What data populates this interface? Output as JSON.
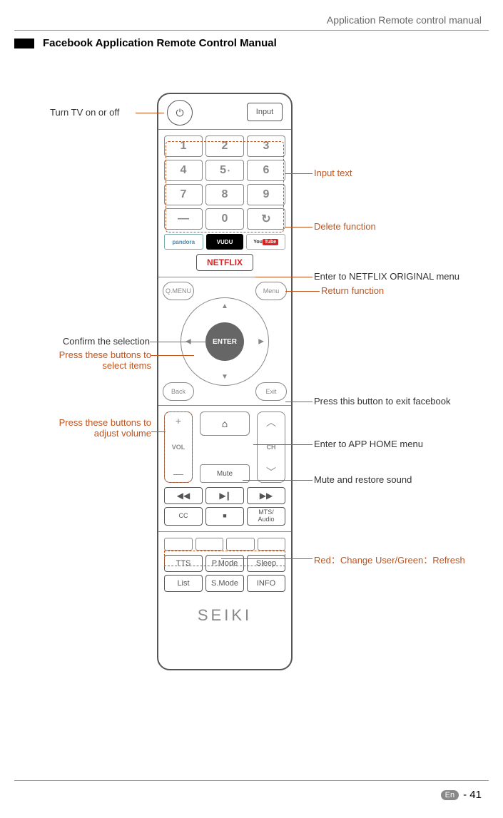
{
  "header": {
    "title": "Application Remote control manual"
  },
  "section_title": "Facebook Application Remote Control Manual",
  "remote": {
    "input": "Input",
    "numbers": [
      "1",
      "2",
      "3",
      "4",
      "5",
      "6",
      "7",
      "8",
      "9",
      "—",
      "0",
      "↻"
    ],
    "apps": {
      "pandora": "pandora",
      "vudu": "VUDU",
      "youtube": "YouTube"
    },
    "netflix": "NETFLIX",
    "qmenu": "Q.MENU",
    "menu": "Menu",
    "enter": "ENTER",
    "back": "Back",
    "exit": "Exit",
    "vol": "VOL",
    "ch": "CH",
    "mute": "Mute",
    "cc": "CC",
    "mts": "MTS/\nAudio",
    "tts": "TTS",
    "pmode": "P.Mode",
    "sleep": "Sleep",
    "list": "List",
    "smode": "S.Mode",
    "info": "INFO",
    "brand": "SEIKI"
  },
  "callouts": {
    "power": "Turn TV on or off",
    "input_text": "Input text",
    "delete": "Delete function",
    "netflix": "Enter to NETFLIX ORIGINAL menu",
    "return": "Return function",
    "confirm": "Confirm the selection",
    "select": "Press these buttons to select items",
    "exit": "Press this button to exit facebook",
    "volume": "Press these buttons to adjust volume",
    "home": "Enter to APP HOME menu",
    "mute": "Mute and restore sound",
    "color": "Red：Change User/Green：Refresh"
  },
  "footer": {
    "lang": "En",
    "page": "- 41"
  }
}
